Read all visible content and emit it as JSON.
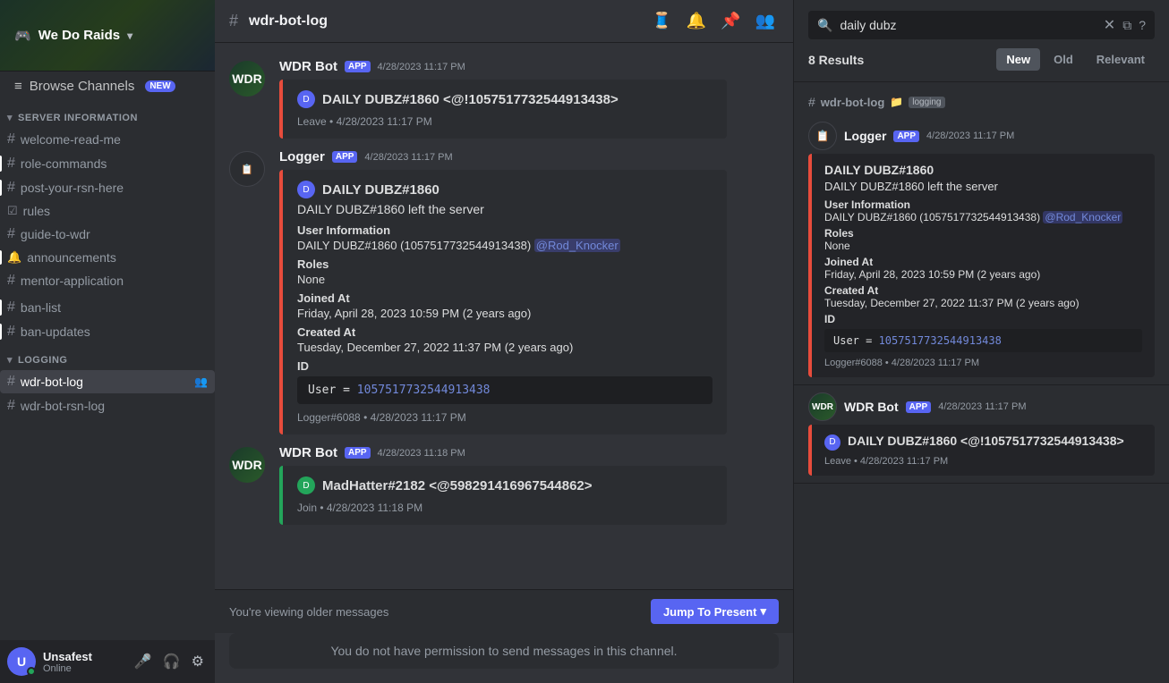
{
  "server": {
    "name": "We Do Raids",
    "chevron": "▾"
  },
  "sidebar": {
    "browse_channels": "Browse Channels",
    "browse_badge": "NEW",
    "categories": [
      {
        "name": "SERVER INFORMATION",
        "channels": [
          {
            "name": "welcome-read-me",
            "icon": "#",
            "active": false
          },
          {
            "name": "role-commands",
            "icon": "#",
            "active": false,
            "indicator": true
          },
          {
            "name": "post-your-rsn-here",
            "icon": "#",
            "active": false,
            "indicator": true
          },
          {
            "name": "rules",
            "icon": "☑",
            "active": false
          },
          {
            "name": "guide-to-wdr",
            "icon": "#",
            "active": false
          },
          {
            "name": "announcements",
            "icon": "🔔",
            "active": false,
            "indicator": true
          },
          {
            "name": "mentor-application",
            "icon": "#",
            "active": false
          }
        ]
      },
      {
        "name": "LOGGING",
        "channels": [
          {
            "name": "wdr-bot-log",
            "icon": "#",
            "active": true,
            "has_manage": true
          },
          {
            "name": "wdr-bot-rsn-log",
            "icon": "#",
            "active": false
          }
        ]
      }
    ],
    "extra_channels": [
      {
        "name": "ban-list",
        "icon": "#",
        "indicator": true
      },
      {
        "name": "ban-updates",
        "icon": "#",
        "indicator": true
      }
    ]
  },
  "channel_header": {
    "name": "wdr-bot-log"
  },
  "messages": [
    {
      "id": "msg1",
      "author": "WDR Bot",
      "app": true,
      "timestamp": "4/28/2023 11:17 PM",
      "avatar_type": "wdr",
      "embed": {
        "color": "red",
        "author_icon": "discord",
        "author_name": "DAILY DUBZ#1860 <@!105751773 2544913438>",
        "description": "",
        "footer": "Leave • 4/28/2023 11:17 PM"
      }
    },
    {
      "id": "msg2",
      "author": "Logger",
      "app": true,
      "timestamp": "4/28/2023 11:17 PM",
      "avatar_type": "logger",
      "embed": {
        "color": "red",
        "author_name": "DAILY DUBZ#1860",
        "description": "DAILY DUBZ#1860 left the server",
        "fields": [
          {
            "name": "User Information",
            "value": "DAILY DUBZ#1860 (105751773 2544913438) @Rod_Knocker"
          },
          {
            "name": "Roles",
            "value": "None"
          },
          {
            "name": "Joined At",
            "value": "Friday, April 28, 2023 10:59 PM (2 years ago)"
          },
          {
            "name": "Created At",
            "value": "Tuesday, December 27, 2022 11:37 PM (2 years ago)"
          },
          {
            "name": "ID",
            "value": "User = 1057517732544913438"
          }
        ],
        "footer": "Logger#6088 • 4/28/2023 11:17 PM"
      }
    },
    {
      "id": "msg3",
      "author": "WDR Bot",
      "app": true,
      "timestamp": "4/28/2023 11:18 PM",
      "avatar_type": "wdr",
      "embed": {
        "color": "green",
        "author_name": "MadHatter#2182 <@59829141696 7544862>",
        "description": "",
        "footer": "Join • 4/28/2023 11:18 PM"
      }
    }
  ],
  "older_banner": {
    "text": "You're viewing older messages",
    "jump_label": "Jump To Present",
    "chevron": "▾"
  },
  "no_permission": "You do not have permission to send messages in this channel.",
  "search": {
    "query": "daily dubz",
    "close_btn": "✕",
    "results_count": "8 Results",
    "sort_options": [
      "New",
      "Old",
      "Relevant"
    ],
    "active_sort": "New",
    "channel_name": "wdr-bot-log",
    "channel_tag": "logging",
    "results": [
      {
        "id": "r1",
        "author": "Logger",
        "app": true,
        "timestamp": "4/28/2023 11:17 PM",
        "avatar_type": "logger",
        "embed": {
          "color": "red",
          "author_name": "DAILY DUBZ#1860",
          "description": "DAILY DUBZ#1860 left the server",
          "fields": [
            {
              "name": "User Information",
              "value": "DAILY DUBZ#1860 (1057517732544913438) @Rod_Knocker"
            },
            {
              "name": "Roles",
              "value": "None"
            },
            {
              "name": "Joined At",
              "value": "Friday, April 28, 2023 10:59 PM (2 years ago)"
            },
            {
              "name": "Created At",
              "value": "Tuesday, December 27, 2022 11:37 PM (2 years ago)"
            },
            {
              "name": "ID",
              "value": "User = 1057517732544913438"
            }
          ],
          "footer": "Logger#6088 • 4/28/2023 11:17 PM"
        }
      },
      {
        "id": "r2",
        "author": "WDR Bot",
        "app": true,
        "timestamp": "4/28/2023 11:17 PM",
        "avatar_type": "wdr",
        "embed": {
          "color": "red",
          "author_name": "DAILY DUBZ#1860 <@!1057517732544913438>",
          "description": "",
          "footer": "Leave • 4/28/2023 11:17 PM"
        }
      }
    ]
  },
  "user": {
    "name": "Unsafest",
    "status": "Online"
  }
}
